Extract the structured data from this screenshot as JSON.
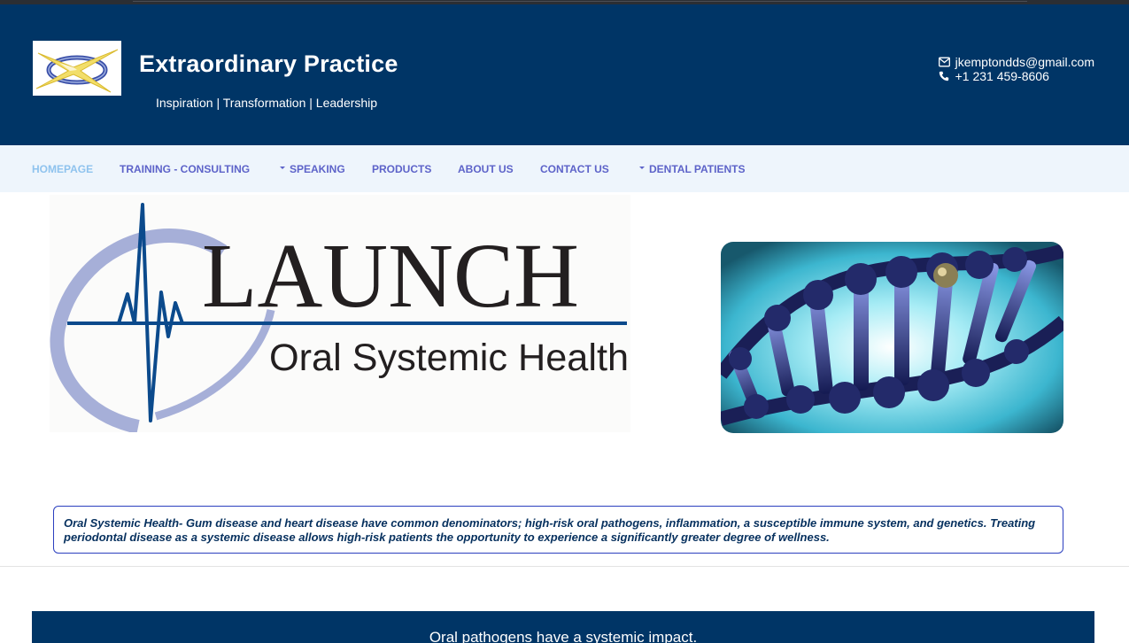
{
  "header": {
    "site_title": "Extraordinary Practice",
    "tagline": "Inspiration | Transformation | Leadership",
    "email": "jkemptondds@gmail.com",
    "phone": "+1 231 459-8606",
    "icons": {
      "email": "envelope-icon",
      "phone": "phone-icon"
    }
  },
  "nav": {
    "items": [
      {
        "label": "HOMEPAGE",
        "active": true
      },
      {
        "label": "TRAINING - CONSULTING"
      },
      {
        "label": "SPEAKING",
        "has_dropdown": true
      },
      {
        "label": "PRODUCTS"
      },
      {
        "label": "ABOUT US"
      },
      {
        "label": "CONTACT US"
      },
      {
        "label": "DENTAL PATIENTS",
        "has_dropdown": true
      }
    ]
  },
  "banner": {
    "launch_title": "LAUNCH",
    "launch_subtitle": "Oral Systemic Health"
  },
  "callout": {
    "text": "Oral Systemic Health- Gum disease and heart disease have common denominators; high-risk oral pathogens, inflammation, a susceptible immune system, and genetics. Treating periodontal disease as a systemic disease allows high-risk patients the opportunity to experience a significantly greater degree of wellness."
  },
  "footer_band": {
    "heading": "Oral pathogens have a systemic impact."
  },
  "colors": {
    "header_bg": "#003566",
    "nav_bg": "#eef5fc",
    "nav_link": "#5d63c9",
    "nav_active": "#8fc3ee",
    "callout_text": "#06305e",
    "callout_border": "#2b3fbf"
  }
}
